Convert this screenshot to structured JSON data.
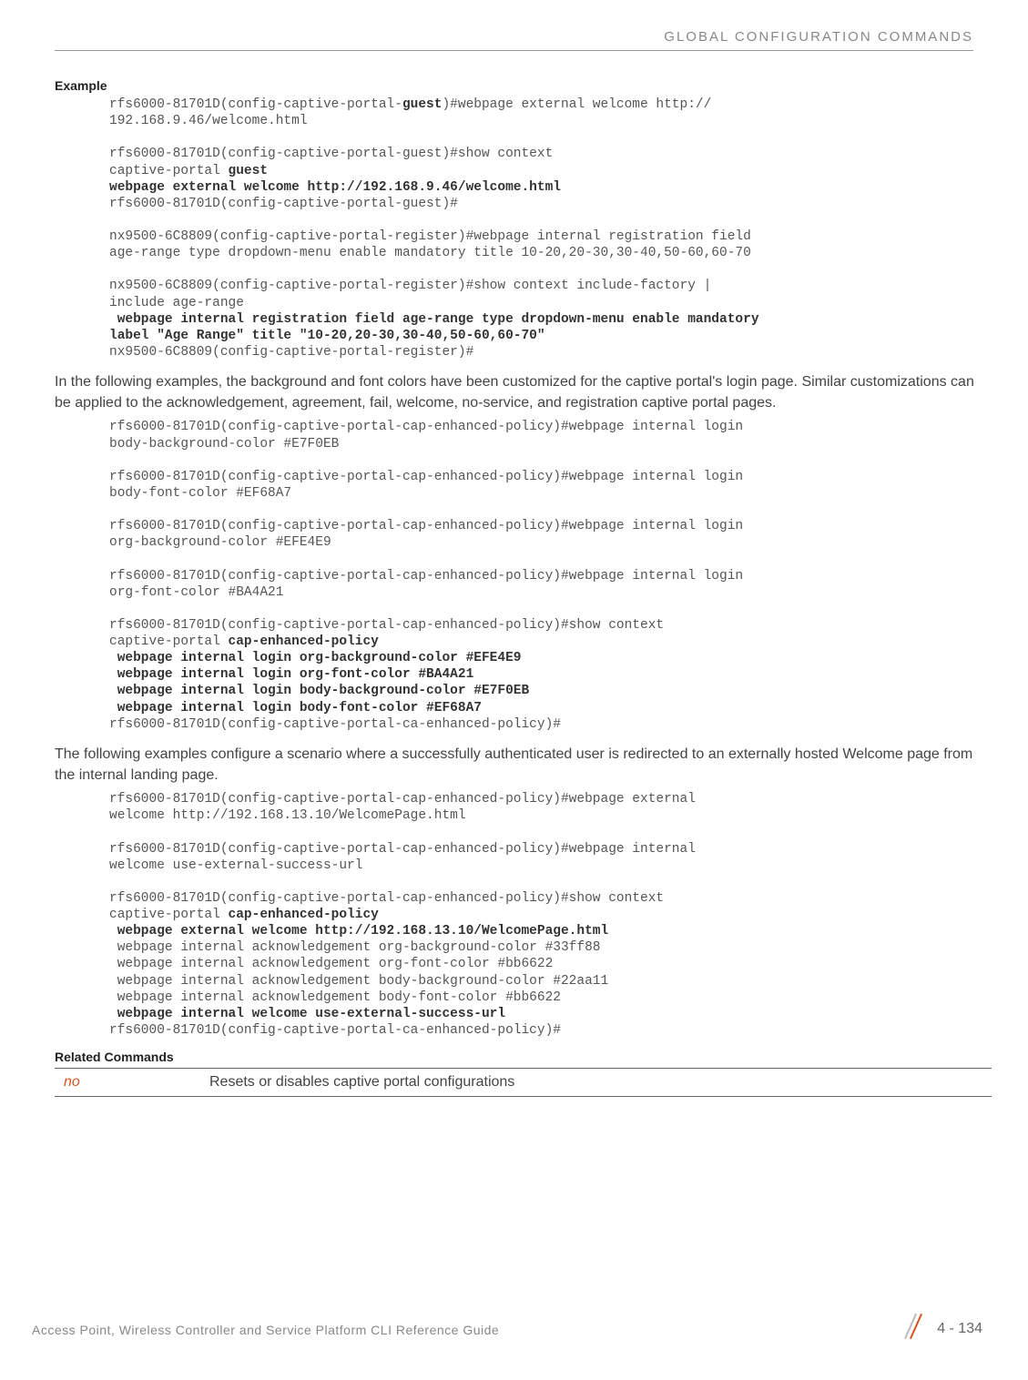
{
  "header": {
    "right_title": "GLOBAL CONFIGURATION COMMANDS"
  },
  "sections": {
    "example_heading": "Example",
    "related_heading": "Related Commands"
  },
  "code": {
    "block1_line1": "rfs6000-81701D(config-captive-portal-",
    "block1_bold1": "guest",
    "block1_line1b": ")#webpage external welcome http://",
    "block1_line2": "192.168.9.46/welcome.html",
    "block1_line3": "",
    "block1_line4": "rfs6000-81701D(config-captive-portal-guest)#show context",
    "block1_line5a": "captive-portal ",
    "block1_bold5": "guest",
    "block1_bold6": "webpage external welcome http://192.168.9.46/welcome.html",
    "block1_line7": "rfs6000-81701D(config-captive-portal-guest)#",
    "block1_line8": "",
    "block1_line9": "nx9500-6C8809(config-captive-portal-register)#webpage internal registration field ",
    "block1_line10": "age-range type dropdown-menu enable mandatory title 10-20,20-30,30-40,50-60,60-70",
    "block1_line11": "",
    "block1_line12": "nx9500-6C8809(config-captive-portal-register)#show context include-factory | ",
    "block1_line13": "include age-range",
    "block1_bold14": " webpage internal registration field age-range type dropdown-menu enable mandatory ",
    "block1_bold15": "label \"Age Range\" title \"10-20,20-30,30-40,50-60,60-70\"",
    "block1_line16": "nx9500-6C8809(config-captive-portal-register)#"
  },
  "para1": "In the following examples, the background and font colors have been customized for the captive portal's login page. Similar customizations can be applied to the acknowledgement, agreement, fail, welcome, no-service, and registration captive portal pages.",
  "code2": {
    "l1": "rfs6000-81701D(config-captive-portal-cap-enhanced-policy)#webpage internal login ",
    "l2": "body-background-color #E7F0EB",
    "l3": "",
    "l4": "rfs6000-81701D(config-captive-portal-cap-enhanced-policy)#webpage internal login ",
    "l5": "body-font-color #EF68A7",
    "l6": "",
    "l7": "rfs6000-81701D(config-captive-portal-cap-enhanced-policy)#webpage internal login ",
    "l8": "org-background-color #EFE4E9",
    "l9": "",
    "l10": "rfs6000-81701D(config-captive-portal-cap-enhanced-policy)#webpage internal login ",
    "l11": "org-font-color #BA4A21",
    "l12": "",
    "l13": "rfs6000-81701D(config-captive-portal-cap-enhanced-policy)#show context",
    "l14a": "captive-portal ",
    "l14b": "cap-enhanced-policy",
    "l15": " webpage internal login org-background-color #EFE4E9",
    "l16": " webpage internal login org-font-color #BA4A21",
    "l17": " webpage internal login body-background-color #E7F0EB",
    "l18": " webpage internal login body-font-color #EF68A7",
    "l19": "rfs6000-81701D(config-captive-portal-ca-enhanced-policy)#"
  },
  "para2": "The following examples configure a scenario where a successfully authenticated user is redirected to an externally hosted Welcome page from the internal landing page.",
  "code3": {
    "l1": "rfs6000-81701D(config-captive-portal-cap-enhanced-policy)#webpage external ",
    "l2": "welcome http://192.168.13.10/WelcomePage.html",
    "l3": "",
    "l4": "rfs6000-81701D(config-captive-portal-cap-enhanced-policy)#webpage internal ",
    "l5": "welcome use-external-success-url",
    "l6": "",
    "l7": "rfs6000-81701D(config-captive-portal-cap-enhanced-policy)#show context",
    "l8a": "captive-portal ",
    "l8b": "cap-enhanced-policy",
    "l9": " webpage external welcome http://192.168.13.10/WelcomePage.html",
    "l10": " webpage internal acknowledgement org-background-color #33ff88",
    "l11": " webpage internal acknowledgement org-font-color #bb6622",
    "l12": " webpage internal acknowledgement body-background-color #22aa11",
    "l13": " webpage internal acknowledgement body-font-color #bb6622",
    "l14": " webpage internal welcome use-external-success-url",
    "l15": "rfs6000-81701D(config-captive-portal-ca-enhanced-policy)#"
  },
  "related": {
    "cmd": "no",
    "desc": "Resets or disables captive portal configurations"
  },
  "footer": {
    "text": "Access Point, Wireless Controller and Service Platform CLI Reference Guide",
    "pagenum": "4 - 134"
  }
}
